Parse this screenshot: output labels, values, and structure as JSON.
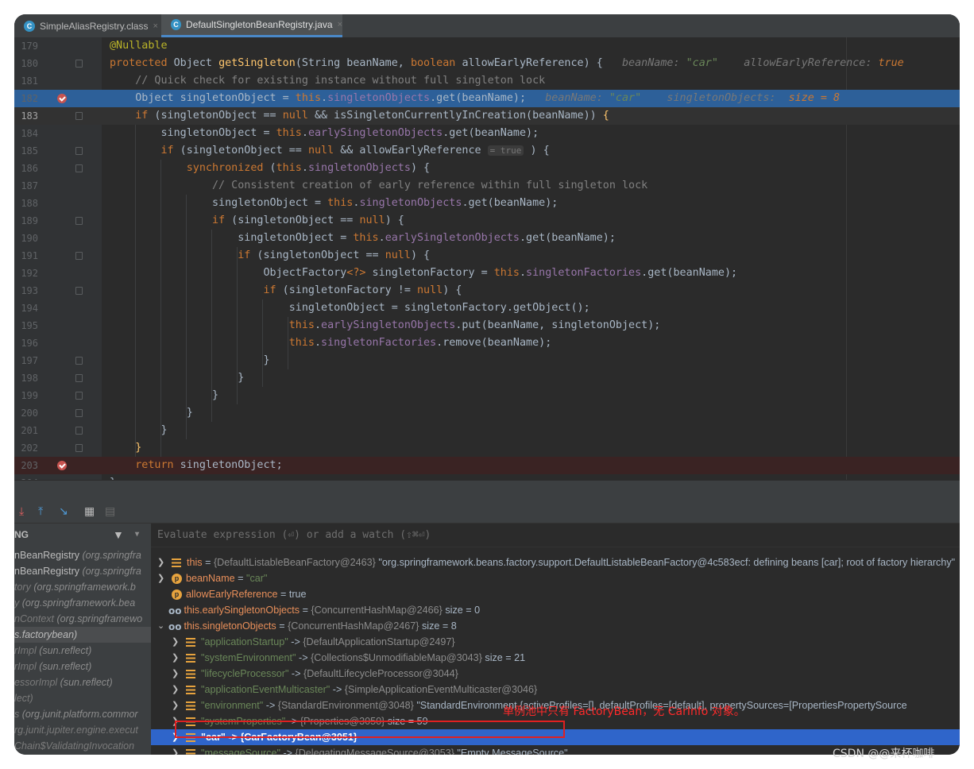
{
  "tabs": [
    {
      "icon": "C",
      "label": "SimpleAliasRegistry.class",
      "close": "×"
    },
    {
      "icon": "C",
      "label": "DefaultSingletonBeanRegistry.java",
      "close": "×"
    }
  ],
  "lines": {
    "179": "179",
    "180": "180",
    "181": "181",
    "182": "182",
    "183": "183",
    "184": "184",
    "185": "185",
    "186": "186",
    "187": "187",
    "188": "188",
    "189": "189",
    "190": "190",
    "191": "191",
    "192": "192",
    "193": "193",
    "194": "194",
    "195": "195",
    "196": "196",
    "197": "197",
    "198": "198",
    "199": "199",
    "200": "200",
    "201": "201",
    "202": "202",
    "203": "203",
    "204": "204"
  },
  "code": {
    "annotation": "@Nullable",
    "kw_protected": "protected",
    "kw_boolean": "boolean",
    "sig_type": "Object",
    "method": "getSingleton",
    "param_str": "String beanName,",
    "param_bool": "allowEarlyReference) {",
    "hint_beanname_label": "beanName:",
    "hint_beanname_val": "\"car\"",
    "hint_allow_label": "allowEarlyReference:",
    "hint_allow_val": "true",
    "comment_181": "// Quick check for existing instance without full singleton lock",
    "l182_a": "Object singletonObject = ",
    "this": "this",
    "l182_field": "singletonObjects",
    "l182_b": ".get(beanName);",
    "hint_so_label": "singletonObjects:",
    "hint_so_val": "size = 8",
    "kw_if": "if",
    "kw_null": "null",
    "l183_a": " (singletonObject == ",
    "l183_b": " && isSingletonCurrentlyInCreation(beanName)) ",
    "brace_open": "{",
    "brace_close": "}",
    "l184_a": "singletonObject = ",
    "l184_field": "earlySingletonObjects",
    "l184_b": ".get(beanName);",
    "l185_b": " && allowEarlyReference ",
    "inline_true": "= true",
    "l185_c": " ) {",
    "kw_synchronized": "synchronized",
    "l186_b": " (",
    "l186_c": ") {",
    "comment_187": "// Consistent creation of early reference within full singleton lock",
    "l188_a": "singletonObject = ",
    "l188_b": ".get(beanName);",
    "l189_b": ") {",
    "l190_a": "singletonObject = ",
    "l190_b": ".get(beanName);",
    "l192_a": "ObjectFactory",
    "l192_gen": "<?>",
    "l192_b": " singletonFactory = ",
    "l192_field": "singletonFactories",
    "l192_c": ".get(beanName);",
    "l193_a": " (singletonFactory != ",
    "l194": "singletonObject = singletonFactory.getObject();",
    "l195_field": "earlySingletonObjects",
    "l195_b": ".put(beanName, singletonObject);",
    "l196_field": "singletonFactories",
    "l196_b": ".remove(beanName);",
    "kw_return": "return",
    "l203_b": " singletonObject;"
  },
  "toolbar": {
    "icons": [
      "step-into-icon",
      "step-out-icon",
      "run-to-cursor-icon",
      "table-icon",
      "grid-icon"
    ]
  },
  "frames": {
    "header": "NG",
    "items": [
      {
        "name": "nBeanRegistry",
        "pkg": " (org.springfra"
      },
      {
        "name": "nBeanRegistry",
        "pkg": " (org.springfra"
      },
      {
        "name": "tory",
        "pkg": " (org.springframework.b"
      },
      {
        "name": "y",
        "pkg": " (org.springframework.bea"
      },
      {
        "name": "nContext",
        "pkg": " (org.springframewo"
      },
      {
        "name": "s.factorybean)",
        "pkg": ""
      },
      {
        "name": "rImpl",
        "pkg": " (sun.reflect)"
      },
      {
        "name": "rImpl",
        "pkg": " (sun.reflect)"
      },
      {
        "name": "essorImpl",
        "pkg": " (sun.reflect)"
      },
      {
        "name": "lect)",
        "pkg": ""
      },
      {
        "name": "s",
        "pkg": " (org.junit.platform.commor"
      },
      {
        "name": "rg.junit.jupiter.engine.execut",
        "pkg": ""
      },
      {
        "name": "Chain$ValidatingInvocation",
        "pkg": ""
      }
    ]
  },
  "vars": {
    "placeholder": "Evaluate expression (⏎) or add a watch (⇧⌘⏎)",
    "rows": [
      {
        "name": "this",
        "sep": " = ",
        "type": "{DefaultListableBeanFactory@2463}",
        "val": " \"org.springframework.beans.factory.support.DefaultListableBeanFactory@4c583ecf: defining beans [car]; root of factory hierarchy\""
      },
      {
        "name": "beanName",
        "sep": " = ",
        "type": "",
        "val": "\"car\""
      },
      {
        "name": "allowEarlyReference",
        "sep": " = ",
        "type": "",
        "val": "true"
      },
      {
        "name": "this.earlySingletonObjects",
        "sep": " = ",
        "type": "{ConcurrentHashMap@2466}",
        "val": " size = 0"
      },
      {
        "name": "this.singletonObjects",
        "sep": " = ",
        "type": "{ConcurrentHashMap@2467}",
        "val": " size = 8"
      },
      {
        "name": "\"applicationStartup\"",
        "sep": " -> ",
        "type": "{DefaultApplicationStartup@2497}",
        "val": ""
      },
      {
        "name": "\"systemEnvironment\"",
        "sep": " -> ",
        "type": "{Collections$UnmodifiableMap@3043}",
        "val": " size = 21"
      },
      {
        "name": "\"lifecycleProcessor\"",
        "sep": " -> ",
        "type": "{DefaultLifecycleProcessor@3044}",
        "val": ""
      },
      {
        "name": "\"applicationEventMulticaster\"",
        "sep": " -> ",
        "type": "{SimpleApplicationEventMulticaster@3046}",
        "val": ""
      },
      {
        "name": "\"environment\"",
        "sep": " -> ",
        "type": "{StandardEnvironment@3048}",
        "val": " \"StandardEnvironment {activeProfiles=[], defaultProfiles=[default], propertySources=[PropertiesPropertySource"
      },
      {
        "name": "\"systemProperties\"",
        "sep": " -> ",
        "type": "{Properties@3050}",
        "val": "  size = 59"
      },
      {
        "name": "\"car\" -> {CarFactoryBean@3051}",
        "sep": "",
        "type": "",
        "val": ""
      },
      {
        "name": "\"messageSource\"",
        "sep": " -> ",
        "type": "{DelegatingMessageSource@3053}",
        "val": " \"Empty MessageSource\""
      }
    ]
  },
  "annotation_note": "单例池中只有 FactoryBean，无 CarInfo 对象。",
  "watermark": "CSDN @@来杯咖啡",
  "colors": {
    "selection": "#2f65ca",
    "breakpoint": "#c75450",
    "highlight_box": "#e02020"
  }
}
